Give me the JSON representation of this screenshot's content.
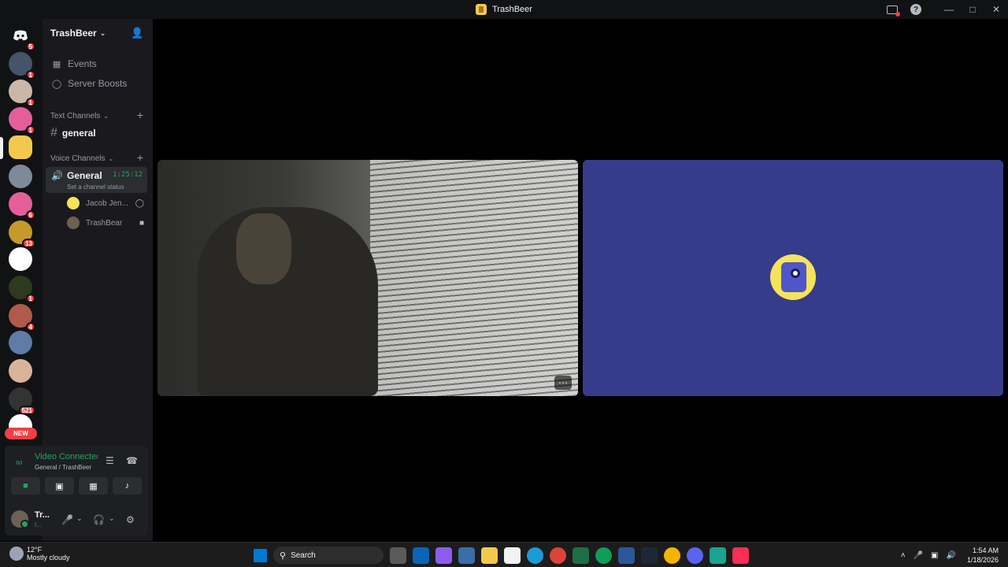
{
  "window": {
    "title": "TrashBeer"
  },
  "rail": {
    "home_badge": "5",
    "servers": [
      {
        "badge": "1",
        "color": "#44546a"
      },
      {
        "badge": "1",
        "color": "#c9b8a8"
      },
      {
        "badge": "1",
        "color": "#e45f9a"
      },
      {
        "badge": "",
        "color": "#f2c94c"
      },
      {
        "badge": "",
        "color": "#7e8a9a"
      },
      {
        "badge": "6",
        "color": "#e45f9a"
      },
      {
        "badge": "13",
        "color": "#c49a2a"
      },
      {
        "badge": "",
        "color": "#ffffff"
      },
      {
        "badge": "1",
        "color": "#2d3a1e"
      },
      {
        "badge": "4",
        "color": "#b05a4a"
      },
      {
        "badge": "",
        "color": "#5d7ca8"
      },
      {
        "badge": "",
        "color": "#d9b49a"
      },
      {
        "badge": "521",
        "color": "#333333"
      },
      {
        "badge": "",
        "color": "#ffffff"
      }
    ],
    "new_label": "NEW"
  },
  "sidebar": {
    "server_name": "TrashBeer",
    "events_label": "Events",
    "boosts_label": "Server Boosts",
    "text_category": "Text Channels",
    "text_channel": "general",
    "voice_category": "Voice Channels",
    "voice_channel": "General",
    "voice_timer": "1:25:12",
    "voice_status": "Set a channel status",
    "members": [
      {
        "name": "Jacob Jen...",
        "color": "#f5e35a"
      },
      {
        "name": "TrashBear",
        "color": "#6d6055"
      }
    ]
  },
  "voice_panel": {
    "status": "Video Connected",
    "location": "General / TrashBeer"
  },
  "user": {
    "name": "Tr...",
    "status": "I..."
  },
  "stage": {
    "avatar_bg": "#373b8b"
  },
  "taskbar": {
    "temp": "12°F",
    "weather": "Mostly cloudy",
    "search_placeholder": "Search",
    "time": "1:54 AM",
    "date": "1/18/2026"
  }
}
